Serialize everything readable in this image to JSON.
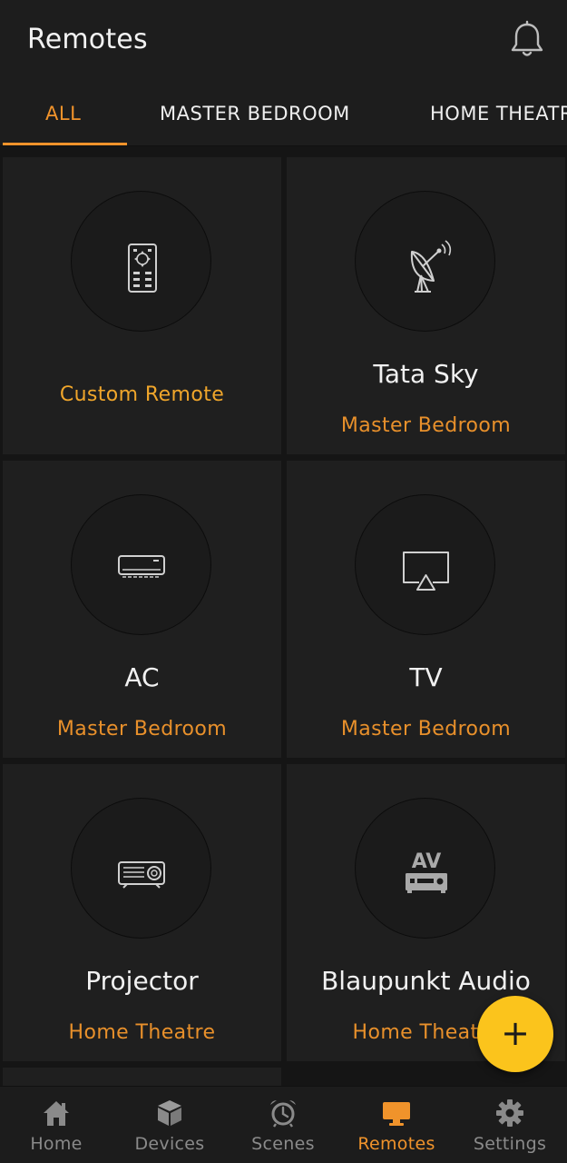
{
  "header": {
    "title": "Remotes",
    "icon": "bell-icon"
  },
  "tabs": [
    {
      "label": "ALL",
      "active": true
    },
    {
      "label": "MASTER BEDROOM",
      "active": false
    },
    {
      "label": "HOME THEATRE",
      "active": false
    }
  ],
  "remotes": [
    {
      "name": "",
      "room": "Custom Remote",
      "icon": "remote-control-icon"
    },
    {
      "name": "Tata Sky",
      "room": "Master Bedroom",
      "icon": "satellite-dish-icon"
    },
    {
      "name": "AC",
      "room": "Master Bedroom",
      "icon": "air-conditioner-icon"
    },
    {
      "name": "TV",
      "room": "Master Bedroom",
      "icon": "tv-airplay-icon"
    },
    {
      "name": "Projector",
      "room": "Home Theatre",
      "icon": "projector-icon"
    },
    {
      "name": "Blaupunkt Audio",
      "room": "Home Theatre",
      "icon": "av-receiver-icon",
      "icon_text": "AV"
    }
  ],
  "fab": {
    "label": "+"
  },
  "nav": [
    {
      "label": "Home",
      "icon": "home-icon",
      "active": false
    },
    {
      "label": "Devices",
      "icon": "cube-icon",
      "active": false
    },
    {
      "label": "Scenes",
      "icon": "alarm-clock-icon",
      "active": false
    },
    {
      "label": "Remotes",
      "icon": "monitor-icon",
      "active": true
    },
    {
      "label": "Settings",
      "icon": "gear-icon",
      "active": false
    }
  ],
  "colors": {
    "accent": "#f0932b",
    "fab": "#fbc41c",
    "background": "#151515",
    "card": "#1f1f1f"
  }
}
